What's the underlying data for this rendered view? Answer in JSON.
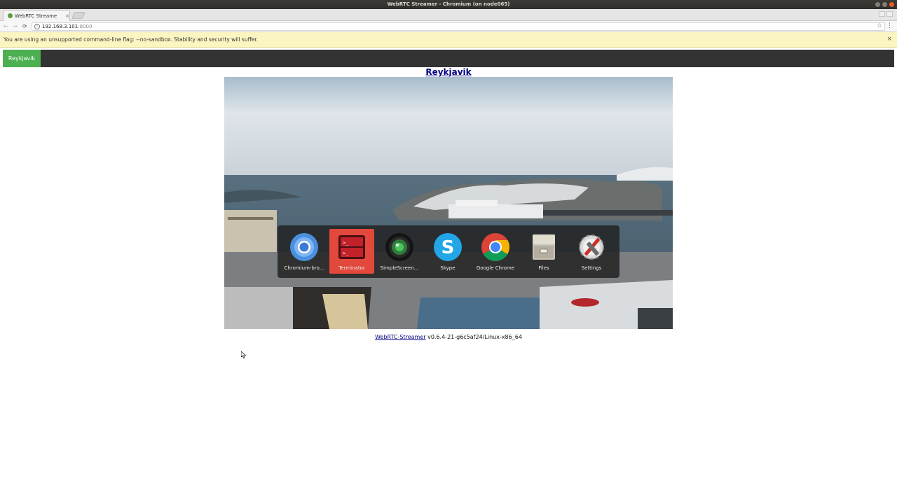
{
  "window": {
    "title": "WebRTC Streamer - Chromium (on node065)"
  },
  "tab": {
    "title": "WebRTC Streame",
    "close": "×"
  },
  "omnibox": {
    "host": "192.168.3.101",
    "port": ":8000",
    "info": "i"
  },
  "icons": {
    "star": "☆",
    "menu": "⋮",
    "back": "←",
    "forward": "→",
    "reload": "⟳"
  },
  "infobar": {
    "message": "You are using an unsupported command-line flag: --no-sandbox. Stability and security will suffer.",
    "close": "×"
  },
  "nav": {
    "tab": "Reykjavik"
  },
  "stream": {
    "title": "Reykjavik"
  },
  "switcher": {
    "apps": [
      {
        "label": "Chromium-bro...",
        "icon": "chromium-icon",
        "selected": false
      },
      {
        "label": "Terminator",
        "icon": "terminator-icon",
        "selected": true
      },
      {
        "label": "SimpleScreen...",
        "icon": "simplescreenrecorder-icon",
        "selected": false
      },
      {
        "label": "Skype",
        "icon": "skype-icon",
        "selected": false
      },
      {
        "label": "Google Chrome",
        "icon": "chrome-icon",
        "selected": false
      },
      {
        "label": "Files",
        "icon": "files-icon",
        "selected": false
      },
      {
        "label": "Settings",
        "icon": "settings-icon",
        "selected": false
      }
    ],
    "accent": "#e2483b"
  },
  "footer": {
    "link": "WebRTC-Streamer",
    "version": " v0.6.4-21-g6c5af24/Linux-x86_64"
  },
  "colors": {
    "navbar": "#333333",
    "active_tab": "#4caf50",
    "infobar": "#fbf5c2",
    "link": "#000080"
  }
}
